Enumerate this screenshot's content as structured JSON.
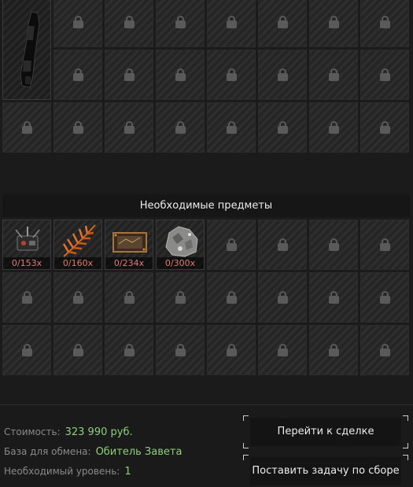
{
  "required_items": {
    "title": "Необходимые предметы",
    "items": [
      {
        "name": "radio-device",
        "count": "0/153x"
      },
      {
        "name": "fern-leaf",
        "count": "0/160x"
      },
      {
        "name": "map-board",
        "count": "0/234x"
      },
      {
        "name": "ore-rock",
        "count": "0/300x"
      }
    ]
  },
  "info": {
    "cost_label": "Стоимость:",
    "cost_value": "323 990 руб.",
    "base_label": "База для обмена:",
    "base_value": "Обитель Завета",
    "level_label": "Необходимый уровень:",
    "level_value": "1"
  },
  "buttons": {
    "go_to_deal": "Перейти к сделке",
    "set_task": "Поставить задачу по сборе"
  },
  "colors": {
    "value_green": "#8ed07a",
    "count_red": "#e07b72"
  },
  "icons": {
    "locked_slot": "lock-icon",
    "result_item": "weapon-icon"
  }
}
